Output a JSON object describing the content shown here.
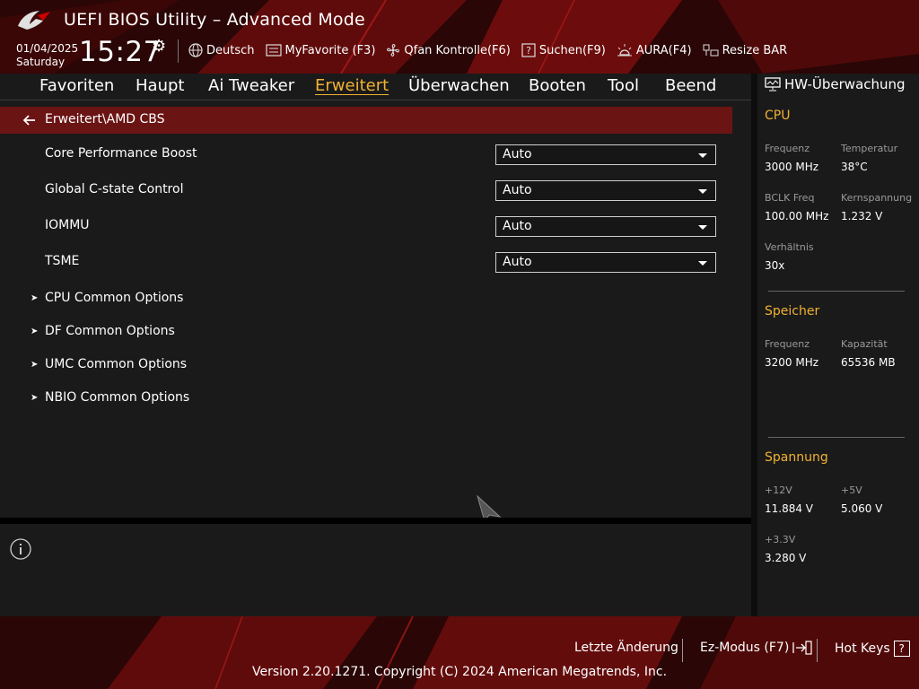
{
  "app": {
    "title": "UEFI BIOS Utility – Advanced Mode"
  },
  "clock": {
    "date": "01/04/2025",
    "weekday": "Saturday",
    "time": "15:27"
  },
  "toolbar": [
    {
      "label": "Deutsch",
      "icon": "globe-icon"
    },
    {
      "label": "MyFavorite (F3)",
      "icon": "favorite-list-icon"
    },
    {
      "label": "Qfan Kontrolle(F6)",
      "icon": "fan-icon"
    },
    {
      "label": "Suchen(F9)",
      "icon": "question-icon"
    },
    {
      "label": "AURA(F4)",
      "icon": "aura-light-icon"
    },
    {
      "label": "Resize BAR",
      "icon": "resize-bar-icon"
    }
  ],
  "nav": {
    "tabs": [
      "Favoriten",
      "Haupt",
      "Ai Tweaker",
      "Erweitert",
      "Überwachen",
      "Booten",
      "Tool",
      "Beend"
    ],
    "active": "Erweitert"
  },
  "breadcrumb": "Erweitert\\AMD CBS",
  "settings": [
    {
      "label": "Core Performance Boost",
      "value": "Auto"
    },
    {
      "label": "Global C-state Control",
      "value": "Auto"
    },
    {
      "label": "IOMMU",
      "value": "Auto"
    },
    {
      "label": "TSME",
      "value": "Auto"
    }
  ],
  "submenus": [
    "CPU Common Options",
    "DF Common Options",
    "UMC Common Options",
    "NBIO Common Options"
  ],
  "hw_monitor": {
    "title": "HW-Überwachung",
    "cpu": {
      "title": "CPU",
      "freq_label": "Frequenz",
      "freq": "3000 MHz",
      "temp_label": "Temperatur",
      "temp": "38°C",
      "bclk_label": "BCLK Freq",
      "bclk": "100.00 MHz",
      "vcore_label": "Kernspannung",
      "vcore": "1.232 V",
      "ratio_label": "Verhältnis",
      "ratio": "30x"
    },
    "memory": {
      "title": "Speicher",
      "freq_label": "Frequenz",
      "freq": "3200 MHz",
      "cap_label": "Kapazität",
      "cap": "65536 MB"
    },
    "voltage": {
      "title": "Spannung",
      "v12_label": "+12V",
      "v12": "11.884 V",
      "v5_label": "+5V",
      "v5": "5.060 V",
      "v33_label": "+3.3V",
      "v33": "3.280 V"
    }
  },
  "footer": {
    "last_change": "Letzte Änderung",
    "ez_mode": "Ez-Modus (F7)",
    "hot_keys": "Hot Keys",
    "hot_keys_icon": "?",
    "copyright": "Version 2.20.1271. Copyright (C) 2024 American Megatrends, Inc."
  },
  "colors": {
    "accent": "#f2b233",
    "breadcrumb_bg": "#6b1414",
    "panel_bg": "#1a1a1a"
  }
}
